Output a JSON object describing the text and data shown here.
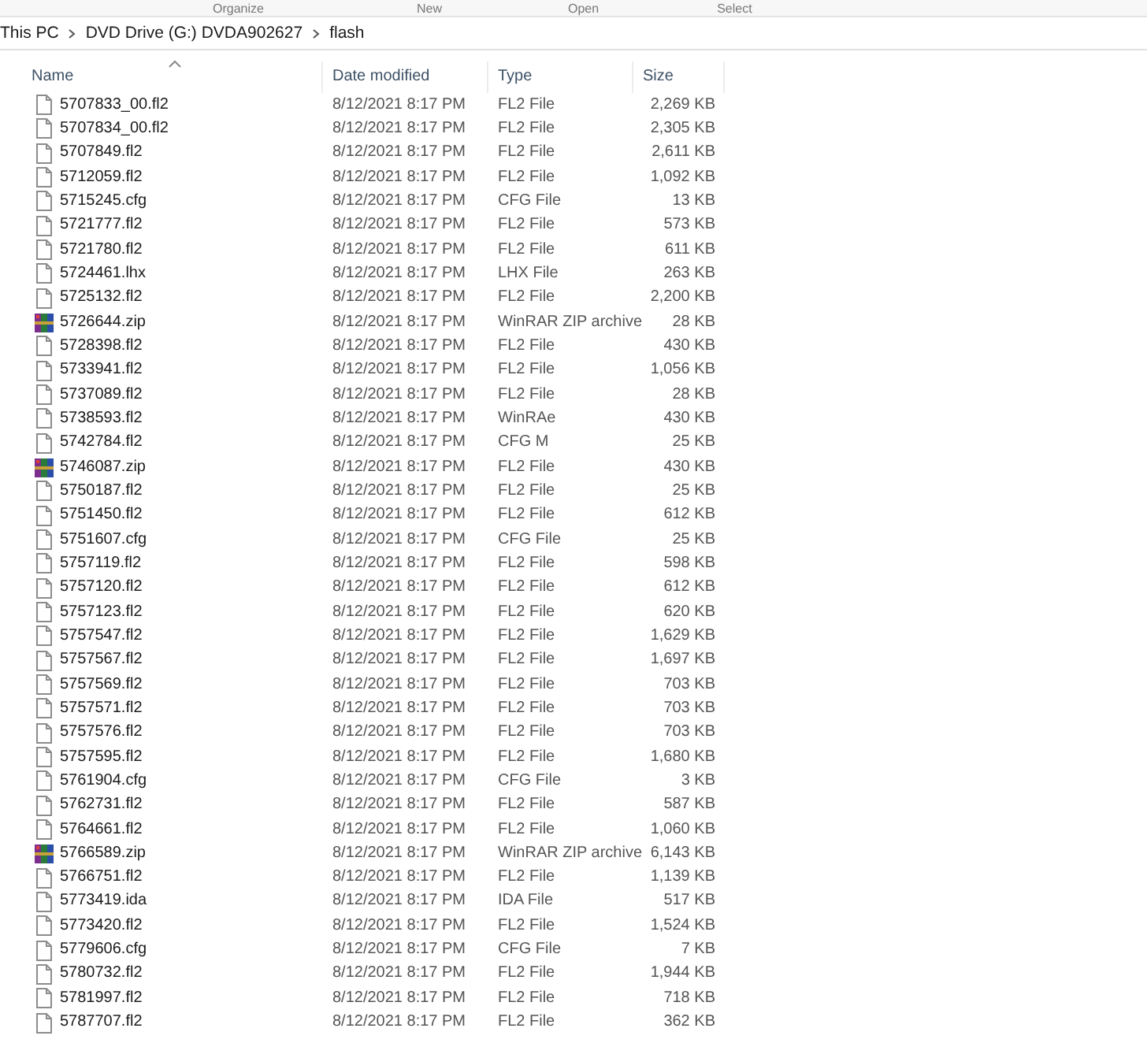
{
  "toolbar": [
    "Organize",
    "New",
    "Open",
    "Select"
  ],
  "breadcrumb": [
    "This PC",
    "DVD Drive (G:) DVDA902627",
    "flash"
  ],
  "table": {
    "columns": [
      "Name",
      "Date modified",
      "Type",
      "Size"
    ],
    "rows": [
      {
        "kind": "file",
        "name": "5707833_00.fl2",
        "date": "8/12/2021 8:17 PM",
        "type": "FL2 File",
        "size": "2,269 KB"
      },
      {
        "kind": "file",
        "name": "5707834_00.fl2",
        "date": "8/12/2021 8:17 PM",
        "type": "FL2 File",
        "size": "2,305 KB"
      },
      {
        "kind": "file",
        "name": "5707849.fl2",
        "date": "8/12/2021 8:17 PM",
        "type": "FL2 File",
        "size": "2,611 KB"
      },
      {
        "kind": "file",
        "name": "5712059.fl2",
        "date": "8/12/2021 8:17 PM",
        "type": "FL2 File",
        "size": "1,092 KB"
      },
      {
        "kind": "file",
        "name": "5715245.cfg",
        "date": "8/12/2021 8:17 PM",
        "type": "CFG File",
        "size": "13 KB"
      },
      {
        "kind": "file",
        "name": "5721777.fl2",
        "date": "8/12/2021 8:17 PM",
        "type": "FL2 File",
        "size": "573 KB"
      },
      {
        "kind": "file",
        "name": "5721780.fl2",
        "date": "8/12/2021 8:17 PM",
        "type": "FL2 File",
        "size": "611 KB"
      },
      {
        "kind": "file",
        "name": "5724461.lhx",
        "date": "8/12/2021 8:17 PM",
        "type": "LHX File",
        "size": "263 KB"
      },
      {
        "kind": "file",
        "name": "5725132.fl2",
        "date": "8/12/2021 8:17 PM",
        "type": "FL2 File",
        "size": "2,200 KB"
      },
      {
        "kind": "archive",
        "name": "5726644.zip",
        "date": "8/12/2021 8:17 PM",
        "type": "WinRAR ZIP archive",
        "size": "28 KB"
      },
      {
        "kind": "file",
        "name": "5728398.fl2",
        "date": "8/12/2021 8:17 PM",
        "type": "FL2 File",
        "size": "430 KB"
      },
      {
        "kind": "file",
        "name": "5733941.fl2",
        "date": "8/12/2021 8:17 PM",
        "type": "FL2 File",
        "size": "1,056 KB"
      },
      {
        "kind": "file",
        "name": "5737089.fl2",
        "date": "8/12/2021 8:17 PM",
        "type": "FL2 File",
        "size": "28 KB"
      },
      {
        "kind": "file",
        "name": "5738593.fl2",
        "date": "8/12/2021 8:17 PM",
        "type": "WinRAe",
        "size": "430 KB"
      },
      {
        "kind": "file",
        "name": "5742784.fl2",
        "date": "8/12/2021 8:17 PM",
        "type": "CFG M",
        "size": "25 KB"
      },
      {
        "kind": "archive",
        "name": "5746087.zip",
        "date": "8/12/2021 8:17 PM",
        "type": "FL2 File",
        "size": "430 KB"
      },
      {
        "kind": "file",
        "name": "5750187.fl2",
        "date": "8/12/2021 8:17 PM",
        "type": "FL2 File",
        "size": "25 KB"
      },
      {
        "kind": "file",
        "name": "5751450.fl2",
        "date": "8/12/2021 8:17 PM",
        "type": "FL2 File",
        "size": "612 KB"
      },
      {
        "kind": "file",
        "name": "5751607.cfg",
        "date": "8/12/2021 8:17 PM",
        "type": "CFG File",
        "size": "25 KB"
      },
      {
        "kind": "file",
        "name": "5757119.fl2",
        "date": "8/12/2021 8:17 PM",
        "type": "FL2 File",
        "size": "598 KB"
      },
      {
        "kind": "file",
        "name": "5757120.fl2",
        "date": "8/12/2021 8:17 PM",
        "type": "FL2 File",
        "size": "612 KB"
      },
      {
        "kind": "file",
        "name": "5757123.fl2",
        "date": "8/12/2021 8:17 PM",
        "type": "FL2 File",
        "size": "620 KB"
      },
      {
        "kind": "file",
        "name": "5757547.fl2",
        "date": "8/12/2021 8:17 PM",
        "type": "FL2 File",
        "size": "1,629 KB"
      },
      {
        "kind": "file",
        "name": "5757567.fl2",
        "date": "8/12/2021 8:17 PM",
        "type": "FL2 File",
        "size": "1,697 KB"
      },
      {
        "kind": "file",
        "name": "5757569.fl2",
        "date": "8/12/2021 8:17 PM",
        "type": "FL2 File",
        "size": "703 KB"
      },
      {
        "kind": "file",
        "name": "5757571.fl2",
        "date": "8/12/2021 8:17 PM",
        "type": "FL2 File",
        "size": "703 KB"
      },
      {
        "kind": "file",
        "name": "5757576.fl2",
        "date": "8/12/2021 8:17 PM",
        "type": "FL2 File",
        "size": "703 KB"
      },
      {
        "kind": "file",
        "name": "5757595.fl2",
        "date": "8/12/2021 8:17 PM",
        "type": "FL2 File",
        "size": "1,680 KB"
      },
      {
        "kind": "file",
        "name": "5761904.cfg",
        "date": "8/12/2021 8:17 PM",
        "type": "CFG File",
        "size": "3 KB"
      },
      {
        "kind": "file",
        "name": "5762731.fl2",
        "date": "8/12/2021 8:17 PM",
        "type": "FL2 File",
        "size": "587 KB"
      },
      {
        "kind": "file",
        "name": "5764661.fl2",
        "date": "8/12/2021 8:17 PM",
        "type": "FL2 File",
        "size": "1,060 KB"
      },
      {
        "kind": "archive",
        "name": "5766589.zip",
        "date": "8/12/2021 8:17 PM",
        "type": "WinRAR ZIP archive",
        "size": "6,143 KB"
      },
      {
        "kind": "file",
        "name": "5766751.fl2",
        "date": "8/12/2021 8:17 PM",
        "type": "FL2 File",
        "size": "1,139 KB"
      },
      {
        "kind": "file",
        "name": "5773419.ida",
        "date": "8/12/2021 8:17 PM",
        "type": "IDA File",
        "size": "517 KB"
      },
      {
        "kind": "file",
        "name": "5773420.fl2",
        "date": "8/12/2021 8:17 PM",
        "type": "FL2 File",
        "size": "1,524 KB"
      },
      {
        "kind": "file",
        "name": "5779606.cfg",
        "date": "8/12/2021 8:17 PM",
        "type": "CFG File",
        "size": "7 KB"
      },
      {
        "kind": "file",
        "name": "5780732.fl2",
        "date": "8/12/2021 8:17 PM",
        "type": "FL2 File",
        "size": "1,944 KB"
      },
      {
        "kind": "file",
        "name": "5781997.fl2",
        "date": "8/12/2021 8:17 PM",
        "type": "FL2 File",
        "size": "718 KB"
      },
      {
        "kind": "file",
        "name": "5787707.fl2",
        "date": "8/12/2021 8:17 PM",
        "type": "FL2 File",
        "size": "362 KB"
      }
    ]
  }
}
